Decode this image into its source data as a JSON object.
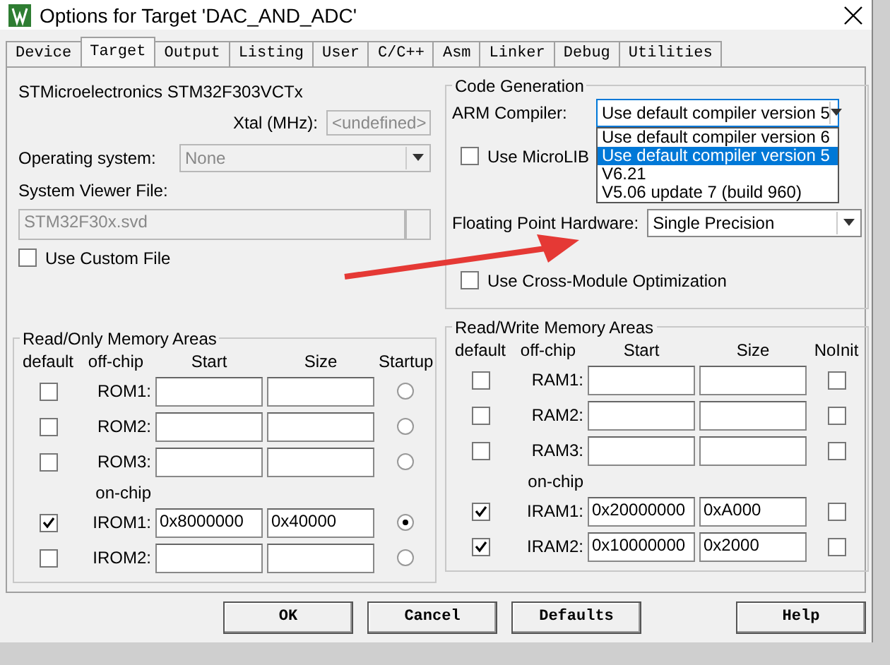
{
  "window": {
    "title": "Options for Target 'DAC_AND_ADC'"
  },
  "tabs": [
    {
      "label": "Device",
      "selected": false
    },
    {
      "label": "Target",
      "selected": true
    },
    {
      "label": "Output",
      "selected": false
    },
    {
      "label": "Listing",
      "selected": false
    },
    {
      "label": "User",
      "selected": false
    },
    {
      "label": "C/C++",
      "selected": false
    },
    {
      "label": "Asm",
      "selected": false
    },
    {
      "label": "Linker",
      "selected": false
    },
    {
      "label": "Debug",
      "selected": false
    },
    {
      "label": "Utilities",
      "selected": false
    }
  ],
  "device": {
    "name": "STMicroelectronics STM32F303VCTx",
    "xtal_label": "Xtal (MHz):",
    "xtal_value": "<undefined>",
    "os_label": "Operating system:",
    "os_value": "None",
    "svd_label": "System Viewer File:",
    "svd_value": "STM32F30x.svd",
    "disabled": true,
    "custom_file": {
      "label": "Use Custom File",
      "checked": false
    }
  },
  "code_generation": {
    "title": "Code Generation",
    "compiler_label": "ARM Compiler:",
    "compiler_value": "Use default compiler version 5",
    "expanded": true,
    "compiler_options": [
      {
        "label": "Use default compiler version 6",
        "selected": false
      },
      {
        "label": "Use default compiler version 5",
        "selected": true
      },
      {
        "label": "V6.21",
        "selected": false
      },
      {
        "label": "V5.06 update 7 (build 960)",
        "selected": false
      }
    ],
    "microlib": {
      "label": "Use MicroLIB",
      "checked": false
    },
    "fpu_label": "Floating Point Hardware:",
    "fpu_value": "Single Precision",
    "cross_module": {
      "label": "Use Cross-Module Optimization",
      "checked": false
    }
  },
  "rom": {
    "title": "Read/Only Memory Areas",
    "columns": [
      "default",
      "off-chip",
      "Start",
      "Size",
      "Startup"
    ],
    "on_chip_label": "on-chip",
    "off_chip_rows": [
      {
        "name": "ROM1:",
        "default": false,
        "startup": false
      },
      {
        "name": "ROM2:",
        "default": false,
        "startup": false
      },
      {
        "name": "ROM3:",
        "default": false,
        "startup": false
      }
    ],
    "on_chip_rows": [
      {
        "name": "IROM1:",
        "default": true,
        "start": "0x8000000",
        "size": "0x40000",
        "startup": true
      },
      {
        "name": "IROM2:",
        "default": false,
        "startup": false
      }
    ]
  },
  "ram": {
    "title": "Read/Write Memory Areas",
    "columns": [
      "default",
      "off-chip",
      "Start",
      "Size",
      "NoInit"
    ],
    "on_chip_label": "on-chip",
    "off_chip_rows": [
      {
        "name": "RAM1:",
        "default": false,
        "noinit": false
      },
      {
        "name": "RAM2:",
        "default": false,
        "noinit": false
      },
      {
        "name": "RAM3:",
        "default": false,
        "noinit": false
      }
    ],
    "on_chip_rows": [
      {
        "name": "IRAM1:",
        "default": true,
        "start": "0x20000000",
        "size": "0xA000",
        "noinit": false
      },
      {
        "name": "IRAM2:",
        "default": true,
        "start": "0x10000000",
        "size": "0x2000",
        "noinit": false
      }
    ]
  },
  "buttons": [
    "OK",
    "Cancel",
    "Defaults",
    "Help"
  ]
}
